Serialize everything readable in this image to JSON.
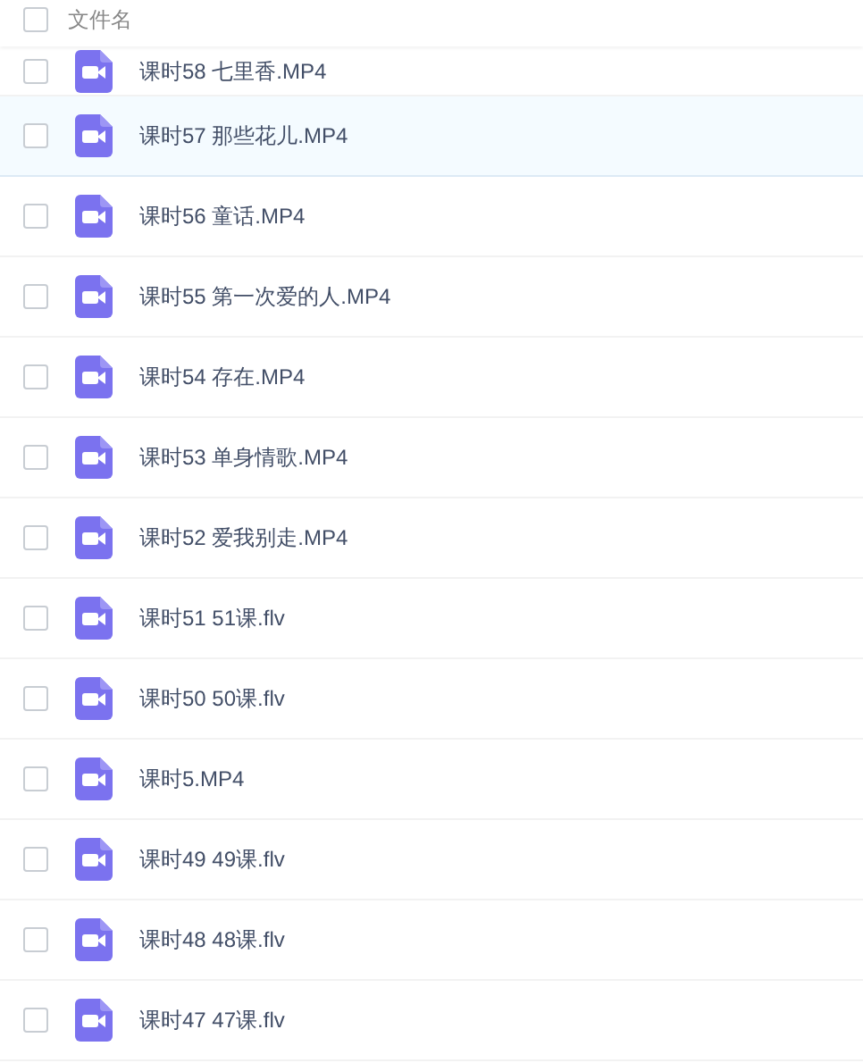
{
  "header": {
    "checked": false,
    "label": "文件名"
  },
  "rows": [
    {
      "name": "课时58 七里香.MP4",
      "checked": false,
      "selected": false
    },
    {
      "name": "课时57 那些花儿.MP4",
      "checked": false,
      "selected": true
    },
    {
      "name": "课时56 童话.MP4",
      "checked": false,
      "selected": false
    },
    {
      "name": "课时55 第一次爱的人.MP4",
      "checked": false,
      "selected": false
    },
    {
      "name": "课时54 存在.MP4",
      "checked": false,
      "selected": false
    },
    {
      "name": "课时53 单身情歌.MP4",
      "checked": false,
      "selected": false
    },
    {
      "name": "课时52 爱我别走.MP4",
      "checked": false,
      "selected": false
    },
    {
      "name": "课时51 51课.flv",
      "checked": false,
      "selected": false
    },
    {
      "name": "课时50 50课.flv",
      "checked": false,
      "selected": false
    },
    {
      "name": "课时5.MP4",
      "checked": false,
      "selected": false
    },
    {
      "name": "课时49 49课.flv",
      "checked": false,
      "selected": false
    },
    {
      "name": "课时48 48课.flv",
      "checked": false,
      "selected": false
    },
    {
      "name": "课时47 47课.flv",
      "checked": false,
      "selected": false
    }
  ]
}
